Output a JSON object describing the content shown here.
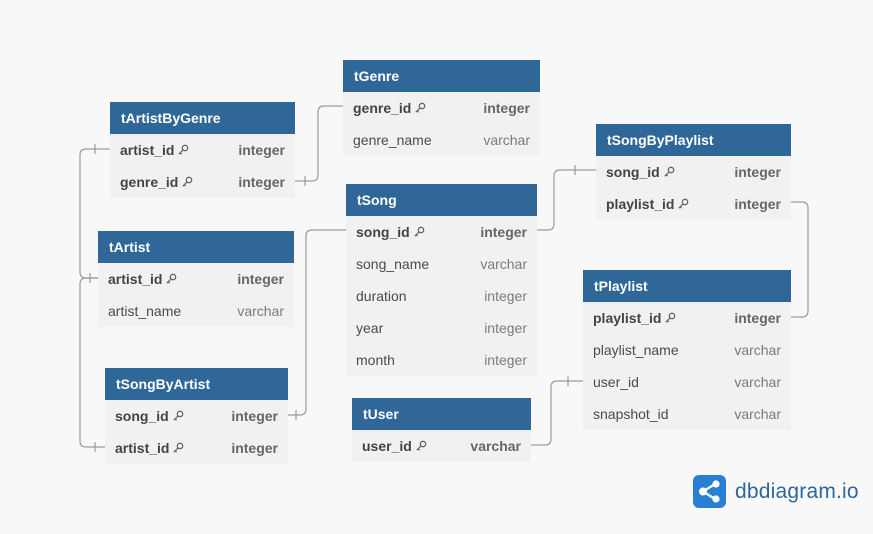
{
  "tables": {
    "tGenre": {
      "name": "tGenre",
      "fields": [
        {
          "name": "genre_id",
          "type": "integer",
          "key": true
        },
        {
          "name": "genre_name",
          "type": "varchar",
          "key": false
        }
      ]
    },
    "tArtistByGenre": {
      "name": "tArtistByGenre",
      "fields": [
        {
          "name": "artist_id",
          "type": "integer",
          "key": true
        },
        {
          "name": "genre_id",
          "type": "integer",
          "key": true
        }
      ]
    },
    "tSongByPlaylist": {
      "name": "tSongByPlaylist",
      "fields": [
        {
          "name": "song_id",
          "type": "integer",
          "key": true
        },
        {
          "name": "playlist_id",
          "type": "integer",
          "key": true
        }
      ]
    },
    "tSong": {
      "name": "tSong",
      "fields": [
        {
          "name": "song_id",
          "type": "integer",
          "key": true
        },
        {
          "name": "song_name",
          "type": "varchar",
          "key": false
        },
        {
          "name": "duration",
          "type": "integer",
          "key": false
        },
        {
          "name": "year",
          "type": "integer",
          "key": false
        },
        {
          "name": "month",
          "type": "integer",
          "key": false
        }
      ]
    },
    "tArtist": {
      "name": "tArtist",
      "fields": [
        {
          "name": "artist_id",
          "type": "integer",
          "key": true
        },
        {
          "name": "artist_name",
          "type": "varchar",
          "key": false
        }
      ]
    },
    "tPlaylist": {
      "name": "tPlaylist",
      "fields": [
        {
          "name": "playlist_id",
          "type": "integer",
          "key": true
        },
        {
          "name": "playlist_name",
          "type": "varchar",
          "key": false
        },
        {
          "name": "user_id",
          "type": "varchar",
          "key": false
        },
        {
          "name": "snapshot_id",
          "type": "varchar",
          "key": false
        }
      ]
    },
    "tSongByArtist": {
      "name": "tSongByArtist",
      "fields": [
        {
          "name": "song_id",
          "type": "integer",
          "key": true
        },
        {
          "name": "artist_id",
          "type": "integer",
          "key": true
        }
      ]
    },
    "tUser": {
      "name": "tUser",
      "fields": [
        {
          "name": "user_id",
          "type": "varchar",
          "key": true
        }
      ]
    }
  },
  "relationships": [
    {
      "from": "tArtistByGenre.genre_id",
      "to": "tGenre.genre_id"
    },
    {
      "from": "tArtistByGenre.artist_id",
      "to": "tArtist.artist_id"
    },
    {
      "from": "tSongByArtist.artist_id",
      "to": "tArtist.artist_id"
    },
    {
      "from": "tSongByArtist.song_id",
      "to": "tSong.song_id"
    },
    {
      "from": "tSong.song_id",
      "to": "tSongByPlaylist.song_id"
    },
    {
      "from": "tSongByPlaylist.playlist_id",
      "to": "tPlaylist.playlist_id"
    },
    {
      "from": "tUser.user_id",
      "to": "tPlaylist.user_id"
    }
  ],
  "logo": {
    "text": "dbdiagram.io",
    "icon": "dbdiagram-logo-icon"
  },
  "colors": {
    "header": "#2f6799",
    "body": "#f1f1f2",
    "edge": "#9a9a9a",
    "background": "#f8f8f9"
  }
}
